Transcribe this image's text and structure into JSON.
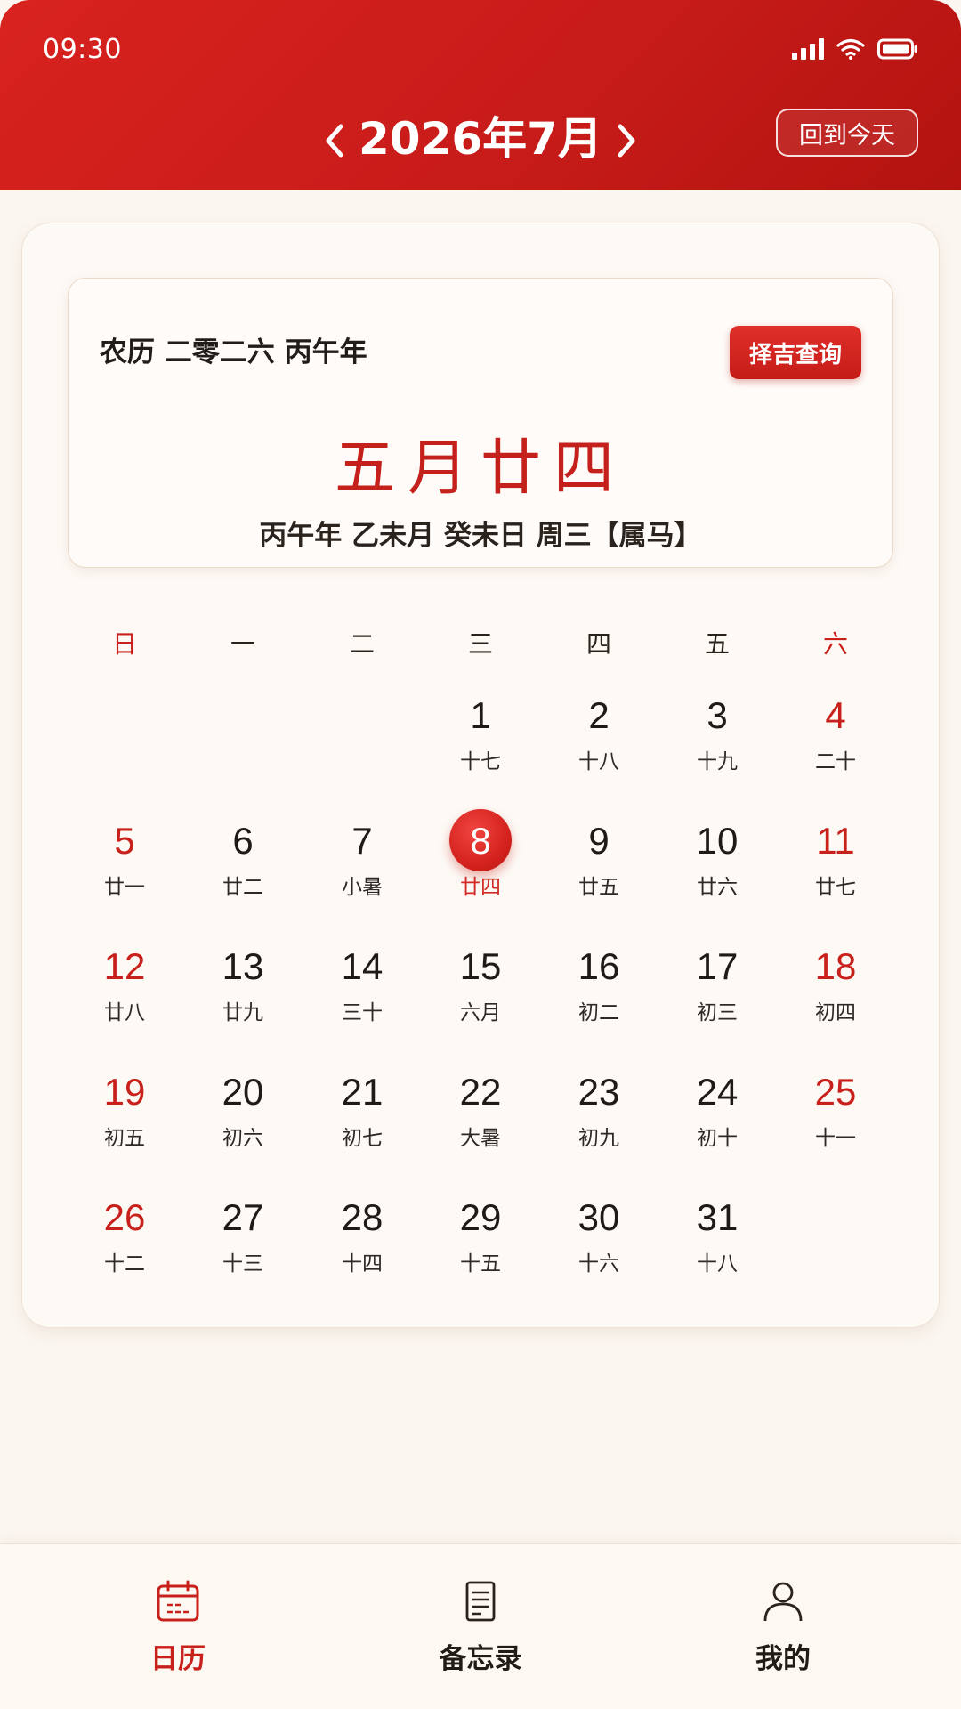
{
  "status_bar": {
    "time": "09:30",
    "icons": [
      "signal-icon",
      "wifi-icon",
      "battery-icon"
    ]
  },
  "header": {
    "title": "2026年7月",
    "today_button": "回到今天",
    "prev_icon": "chevron-left-icon",
    "next_icon": "chevron-right-icon"
  },
  "lunar_card": {
    "year_text": "农历 二零二六 丙午年",
    "select_button": "择吉查询",
    "lunar_date": "五月廿四",
    "ganzhi": "丙午年 乙未月 癸未日 周三【属马】"
  },
  "weekdays": [
    "日",
    "一",
    "二",
    "三",
    "四",
    "五",
    "六"
  ],
  "calendar": {
    "first_weekday": 3,
    "selected_day": 8,
    "days": [
      {
        "day": "1",
        "lunar": "十七"
      },
      {
        "day": "2",
        "lunar": "十八"
      },
      {
        "day": "3",
        "lunar": "十九"
      },
      {
        "day": "4",
        "lunar": "二十"
      },
      {
        "day": "5",
        "lunar": "廿一"
      },
      {
        "day": "6",
        "lunar": "廿二"
      },
      {
        "day": "7",
        "lunar": "小暑"
      },
      {
        "day": "8",
        "lunar": "廿四"
      },
      {
        "day": "9",
        "lunar": "廿五"
      },
      {
        "day": "10",
        "lunar": "廿六"
      },
      {
        "day": "11",
        "lunar": "廿七"
      },
      {
        "day": "12",
        "lunar": "廿八"
      },
      {
        "day": "13",
        "lunar": "廿九"
      },
      {
        "day": "14",
        "lunar": "三十"
      },
      {
        "day": "15",
        "lunar": "六月"
      },
      {
        "day": "16",
        "lunar": "初二"
      },
      {
        "day": "17",
        "lunar": "初三"
      },
      {
        "day": "18",
        "lunar": "初四"
      },
      {
        "day": "19",
        "lunar": "初五"
      },
      {
        "day": "20",
        "lunar": "初六"
      },
      {
        "day": "21",
        "lunar": "初七"
      },
      {
        "day": "22",
        "lunar": "大暑"
      },
      {
        "day": "23",
        "lunar": "初九"
      },
      {
        "day": "24",
        "lunar": "初十"
      },
      {
        "day": "25",
        "lunar": "十一"
      },
      {
        "day": "26",
        "lunar": "十二"
      },
      {
        "day": "27",
        "lunar": "十三"
      },
      {
        "day": "28",
        "lunar": "十四"
      },
      {
        "day": "29",
        "lunar": "十五"
      },
      {
        "day": "30",
        "lunar": "十六"
      },
      {
        "day": "31",
        "lunar": "十八"
      }
    ]
  },
  "bottom_nav": [
    {
      "label": "日历",
      "icon": "calendar-icon",
      "active": true
    },
    {
      "label": "备忘录",
      "icon": "memo-icon",
      "active": false
    },
    {
      "label": "我的",
      "icon": "user-icon",
      "active": false
    }
  ],
  "colors": {
    "brand_red": "#c8211c",
    "header_red": "#d8221e",
    "background": "#fbf6f0"
  }
}
